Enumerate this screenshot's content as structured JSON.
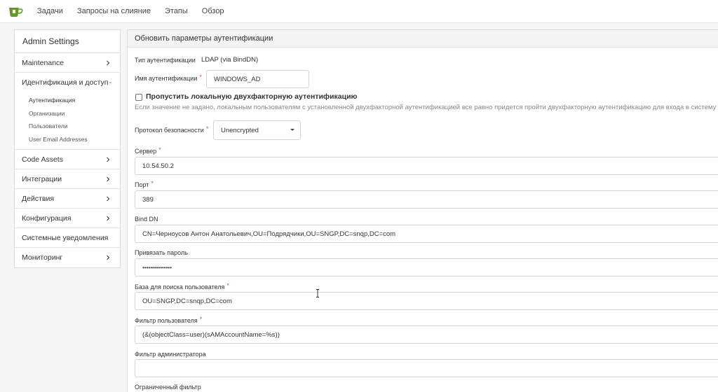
{
  "topnav": {
    "logo_icon": "gitea-teacup-icon",
    "links": [
      "Задачи",
      "Запросы на слияние",
      "Этапы",
      "Обзор"
    ]
  },
  "sidebar": {
    "header": "Admin Settings",
    "items": [
      {
        "label": "Maintenance",
        "icon": "chevron-right-icon"
      },
      {
        "label": "Идентификация и доступ",
        "icon": "chevron-down-icon"
      },
      {
        "label": "Code Assets",
        "icon": "chevron-right-icon"
      },
      {
        "label": "Интеграции",
        "icon": "chevron-right-icon"
      },
      {
        "label": "Действия",
        "icon": "chevron-right-icon"
      },
      {
        "label": "Конфигурация",
        "icon": "chevron-right-icon"
      },
      {
        "label": "Системные уведомления",
        "icon": ""
      },
      {
        "label": "Мониторинг",
        "icon": "chevron-right-icon"
      }
    ],
    "subitems": [
      "Аутентификация",
      "Организации",
      "Пользователи",
      "User Email Addresses"
    ],
    "active_subitem": "Аутентификация"
  },
  "main": {
    "title": "Обновить параметры аутентификации",
    "auth_type": {
      "label": "Тип аутентификации",
      "value": "LDAP (via BindDN)"
    },
    "auth_name": {
      "label": "Имя аутентификации",
      "value": "WINDOWS_AD",
      "required": "*"
    },
    "skip_2fa": {
      "label": "Пропустить локальную двухфакторную аутентификацию",
      "checked": false,
      "hint": "Если значение не задано, локальным пользователям с установленной двухфакторной аутентификацией все равно придется пройти двухфакторную аутентификацию для входа в систему"
    },
    "security_protocol": {
      "label": "Протокол безопасности",
      "value": "Unencrypted",
      "required": "*"
    },
    "server": {
      "label": "Сервер",
      "value": "10.54.50.2",
      "required": "*"
    },
    "port": {
      "label": "Порт",
      "value": "389",
      "required": "*"
    },
    "bind_dn": {
      "label": "Bind DN",
      "value": "CN=Черноусов Антон Анатольевич,OU=Подрядчики,OU=SNGP,DC=snqp,DC=com"
    },
    "bind_password": {
      "label": "Привязать пароль",
      "value": "•••••••••••••••"
    },
    "user_search_base": {
      "label": "База для поиска пользователя",
      "value": "OU=SNGP,DC=snqp,DC=com",
      "required": "*"
    },
    "user_filter": {
      "label": "Фильтр пользователя",
      "value": "(&(objectClass=user)(sAMAccountName=%s))",
      "required": "*"
    },
    "admin_filter": {
      "label": "Фильтр администратора",
      "value": ""
    },
    "restricted_filter": {
      "label": "Ограниченный фильтр"
    }
  }
}
